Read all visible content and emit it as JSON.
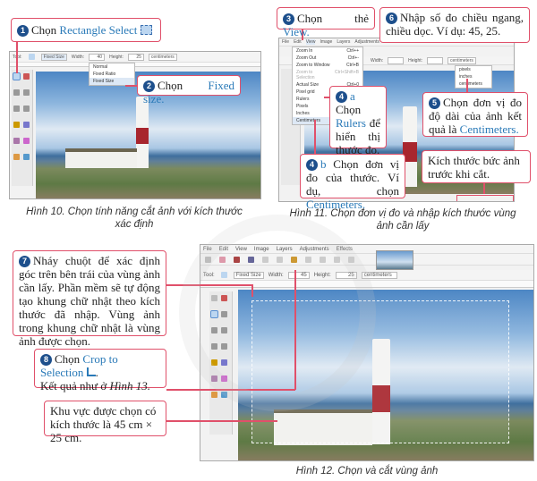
{
  "fig10": {
    "caption": "Hình 10. Chọn tính năng cắt ảnh với kích thước xác định",
    "toolbar": {
      "tool_label": "Tool:",
      "mode": "Fixed Size",
      "width_label": "Width:",
      "width_value": "40",
      "height_label": "Height:",
      "height_value": "25",
      "unit": "centimeters"
    },
    "mode_menu": [
      "Normal",
      "Fixed Ratio",
      "Fixed Size"
    ],
    "callout1": {
      "num": "1",
      "text": "Chọn ",
      "highlight": "Rectangle Select",
      "icon": "rectangle-select-icon"
    },
    "callout2": {
      "num": "2",
      "text": "Chọn ",
      "highlight": "Fixed size."
    }
  },
  "fig11": {
    "caption": "Hình 11. Chọn đơn vị đo và nhập kích thước vùng ảnh cần lấy",
    "menubar": [
      "File",
      "Edit",
      "View",
      "Image",
      "Layers",
      "Adjustments",
      "Effects"
    ],
    "view_menu": [
      {
        "label": "Zoom In",
        "shortcut": "Ctrl++"
      },
      {
        "label": "Zoom Out",
        "shortcut": "Ctrl+-"
      },
      {
        "label": "Zoom to Window",
        "shortcut": "Ctrl+B"
      },
      {
        "label": "Zoom to Selection",
        "shortcut": "Ctrl+Shift+B"
      },
      {
        "label": "Actual Size",
        "shortcut": "Ctrl+0"
      },
      {
        "label": "Pixel grid",
        "shortcut": ""
      },
      {
        "label": "Rulers",
        "shortcut": ""
      },
      {
        "label": "Pixels",
        "shortcut": ""
      },
      {
        "label": "Inches",
        "shortcut": ""
      },
      {
        "label": "Centimeters",
        "shortcut": ""
      }
    ],
    "unit_menu": [
      "pixels",
      "inches",
      "centimeters"
    ],
    "toolbar": {
      "width_label": "Width:",
      "height_label": "Height:",
      "unit": "centimeters"
    },
    "callout3": {
      "num": "3",
      "text": "Chọn thẻ ",
      "highlight": "View."
    },
    "callout6": {
      "num": "6",
      "text": "Nhập số đo chiều ngang, chiều dọc. Ví dụ: 45, 25."
    },
    "callout4a": {
      "num": "4",
      "suffix": "a",
      "text1": " Chọn ",
      "highlight": "Rulers",
      "text2": " để hiển thị thước đo."
    },
    "callout5": {
      "num": "5",
      "text": "Chọn đơn vị đo độ dài của ảnh kết quả là ",
      "highlight": "Centimeters."
    },
    "callout4b": {
      "num": "4",
      "suffix": "b",
      "text": " Chọn đơn vị đo của thước. Ví dụ, chọn ",
      "highlight": "Centimeters."
    },
    "callout_size": {
      "text": "Kích thước bức ảnh trước khi cắt."
    }
  },
  "fig12": {
    "caption": "Hình 12. Chọn và cắt vùng ảnh",
    "menubar": [
      "File",
      "Edit",
      "View",
      "Image",
      "Layers",
      "Adjustments",
      "Effects"
    ],
    "toolbar": {
      "tool_label": "Tool:",
      "mode": "Fixed Size",
      "width_label": "Width:",
      "width_value": "45",
      "height_label": "Height:",
      "height_value": "25",
      "unit": "centimeters"
    },
    "callout7": {
      "num": "7",
      "text": "Nháy chuột để xác định góc trên bên trái của vùng ảnh cần lấy. Phần mềm sẽ tự động tạo khung chữ nhật theo kích thước đã nhập. Vùng ảnh trong khung chữ nhật là vùng ảnh được chọn."
    },
    "callout8": {
      "num": "8",
      "text": "Chọn ",
      "highlight": "Crop to Selection",
      "line2": "Kết quả như ở ",
      "ref": "Hình 13."
    },
    "callout_area": {
      "text": "Khu vực được chọn có kích thước là 45 cm × 25 cm."
    }
  },
  "colors": {
    "callout_border": "#e0506a",
    "highlight": "#2a7ab8",
    "number_badge": "#1d4f8c"
  }
}
